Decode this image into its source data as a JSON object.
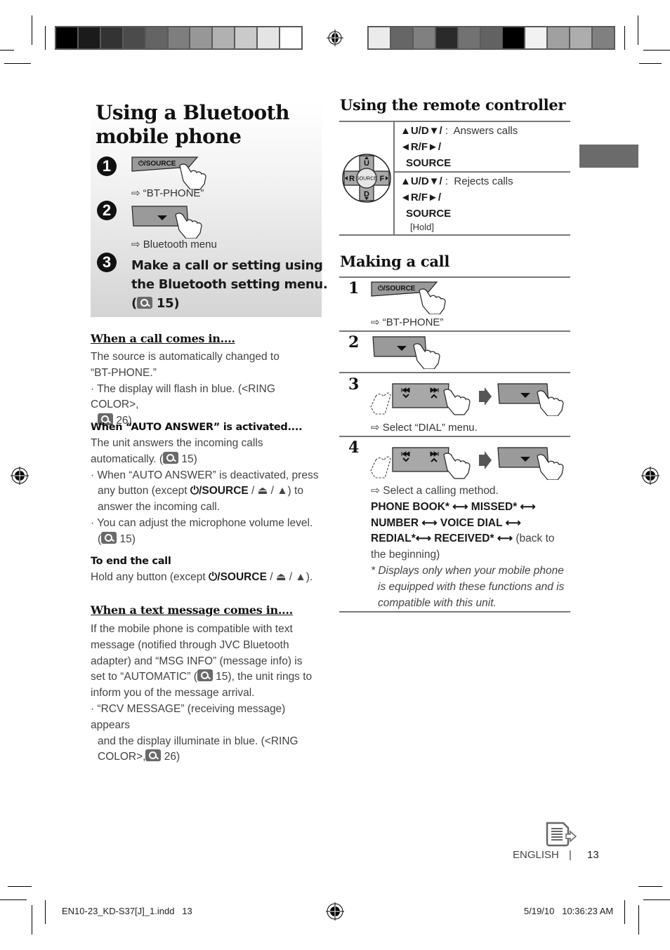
{
  "print_marks": {
    "left_bar_colors": [
      "#000000",
      "#1b1b1b",
      "#333333",
      "#4b4b4b",
      "#646464",
      "#7e7e7e",
      "#979797",
      "#b1b1b1",
      "#cacaca",
      "#e4e4e4",
      "#ffffff"
    ],
    "right_bar_colors": [
      "#ebebeb",
      "#666666",
      "#808080",
      "#2a2a2a",
      "#727272",
      "#626262",
      "#000000",
      "#f2f2f2",
      "#a0a0a0",
      "#adadad",
      "#808080"
    ]
  },
  "left_panel": {
    "title_line1": "Using a Bluetooth",
    "title_line2": "mobile phone",
    "steps": [
      {
        "num": "1",
        "button_label": "⏻/SOURCE",
        "result": "“BT-PHONE”"
      },
      {
        "num": "2",
        "button_label": "▼",
        "result": "Bluetooth menu"
      },
      {
        "num": "3",
        "text_line1": "Make a call or setting using",
        "text_line2": "the Bluetooth setting menu.",
        "ref_open": "(",
        "ref_page": "15)"
      }
    ]
  },
  "call_comes_in": {
    "heading": "When a call comes in....",
    "line1": "The source is automatically changed to",
    "line2": "“BT-PHONE.”",
    "bullet1_a": "· The display will flash in blue. (<RING COLOR>,",
    "bullet1_b": "26)"
  },
  "auto_answer": {
    "heading": "When “AUTO ANSWER” is activated....",
    "line1": "The unit answers the incoming calls",
    "line2_a": "automatically. (",
    "line2_b": "15)",
    "bullet1_a": "· When “AUTO ANSWER” is deactivated, press",
    "bullet1_b_pre": "any button (except ",
    "bullet1_b_bold": "⏻/SOURCE",
    "bullet1_b_post": " / ⏏ / ▲) to",
    "bullet1_c": "answer the incoming call.",
    "bullet2_a": "· You can adjust the microphone volume level.",
    "bullet2_b_open": "(",
    "bullet2_b": "15)"
  },
  "end_call": {
    "heading": "To end the call",
    "line_pre": "Hold any button (except ",
    "line_bold": "⏻/SOURCE",
    "line_post": " / ⏏ / ▲)."
  },
  "text_message": {
    "heading": "When a text message comes in....",
    "line1": "If the mobile phone is compatible with text",
    "line2": "message (notified through JVC Bluetooth",
    "line3": "adapter) and “MSG INFO” (message info) is",
    "line4_a": "set to “AUTOMATIC” (",
    "line4_b": "15), the unit rings to",
    "line5": "inform you of the message arrival.",
    "bullet1_a": "· “RCV MESSAGE” (receiving message) appears",
    "bullet1_b": "and the display illuminate in blue. (<RING",
    "bullet1_c_a": "COLOR>,",
    "bullet1_c_b": "26)"
  },
  "remote": {
    "heading": "Using the remote controller",
    "pad_labels": {
      "up": "U",
      "down": "D",
      "left": "R",
      "right": "F",
      "center": "SOURCE"
    },
    "rows": [
      {
        "keys_line1": "▲U/D▼/",
        "sep": ":",
        "action": "Answers calls",
        "keys_line2": "◄R/F►/",
        "keys_line3": "SOURCE",
        "note": ""
      },
      {
        "keys_line1": "▲U/D▼/",
        "sep": ":",
        "action": "Rejects calls",
        "keys_line2": "◄R/F►/",
        "keys_line3": "SOURCE",
        "note": "[Hold]"
      }
    ]
  },
  "making_call": {
    "heading": "Making a call",
    "steps": [
      {
        "num": "1",
        "button_label": "⏻/SOURCE",
        "result": "“BT-PHONE”"
      },
      {
        "num": "2",
        "button_label": "▼"
      },
      {
        "num": "3",
        "result": "Select “DIAL” menu."
      },
      {
        "num": "4",
        "result": "Select a calling method."
      }
    ],
    "methods_line1": "PHONE BOOK* ⟷ MISSED* ⟷",
    "methods_line2": "NUMBER ⟷ VOICE DIAL ⟷",
    "methods_line3_bold": "REDIAL*⟷ RECEIVED* ⟷",
    "methods_line3_tail": " (back to",
    "methods_line4": "the beginning)",
    "footnote1": "* Displays only when your mobile phone",
    "footnote2": "is equipped with these functions and is",
    "footnote3": "compatible with this unit."
  },
  "footer": {
    "language": "ENGLISH",
    "separator": "|",
    "page_number": "13",
    "file_slug": "EN10-23_KD-S37[J]_1.indd   13",
    "timestamp": "5/19/10   10:36:23 AM"
  }
}
